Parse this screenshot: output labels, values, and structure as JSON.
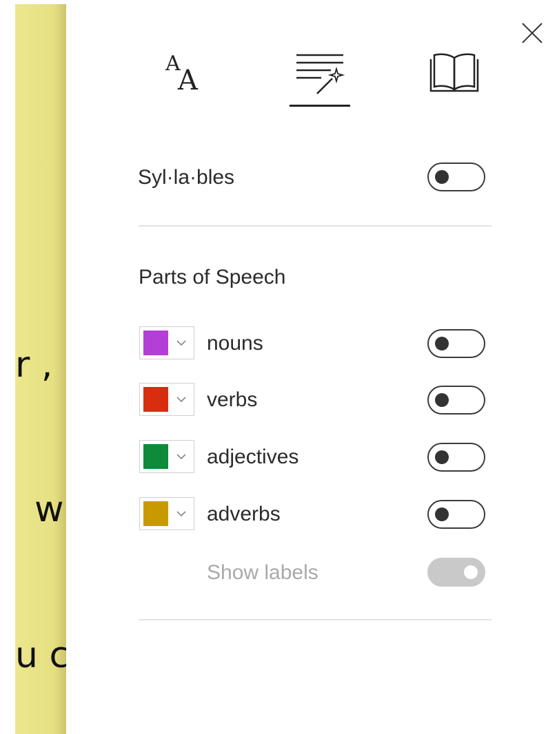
{
  "background_page": {
    "fragments": [
      "r ,",
      "w",
      "u c"
    ]
  },
  "tabs": [
    {
      "name": "text-preferences",
      "icon": "text-size-icon",
      "active": false
    },
    {
      "name": "grammar-options",
      "icon": "grammar-magic-wand-icon",
      "active": true
    },
    {
      "name": "reading-preferences",
      "icon": "open-book-icon",
      "active": false
    }
  ],
  "syllables": {
    "label": "Syl·la·bles",
    "enabled": false
  },
  "parts_of_speech": {
    "heading": "Parts of Speech",
    "items": [
      {
        "label": "nouns",
        "color": "#b43fd6",
        "enabled": false
      },
      {
        "label": "verbs",
        "color": "#d72e10",
        "enabled": false
      },
      {
        "label": "adjectives",
        "color": "#0e8a3a",
        "enabled": false
      },
      {
        "label": "adverbs",
        "color": "#c99a00",
        "enabled": false
      }
    ],
    "show_labels": {
      "label": "Show labels",
      "enabled": true,
      "disabled": true
    }
  },
  "colors": {
    "toggle_border": "#3a3a3a",
    "disabled": "#c9c9c9",
    "page_bg": "#e6e083"
  }
}
